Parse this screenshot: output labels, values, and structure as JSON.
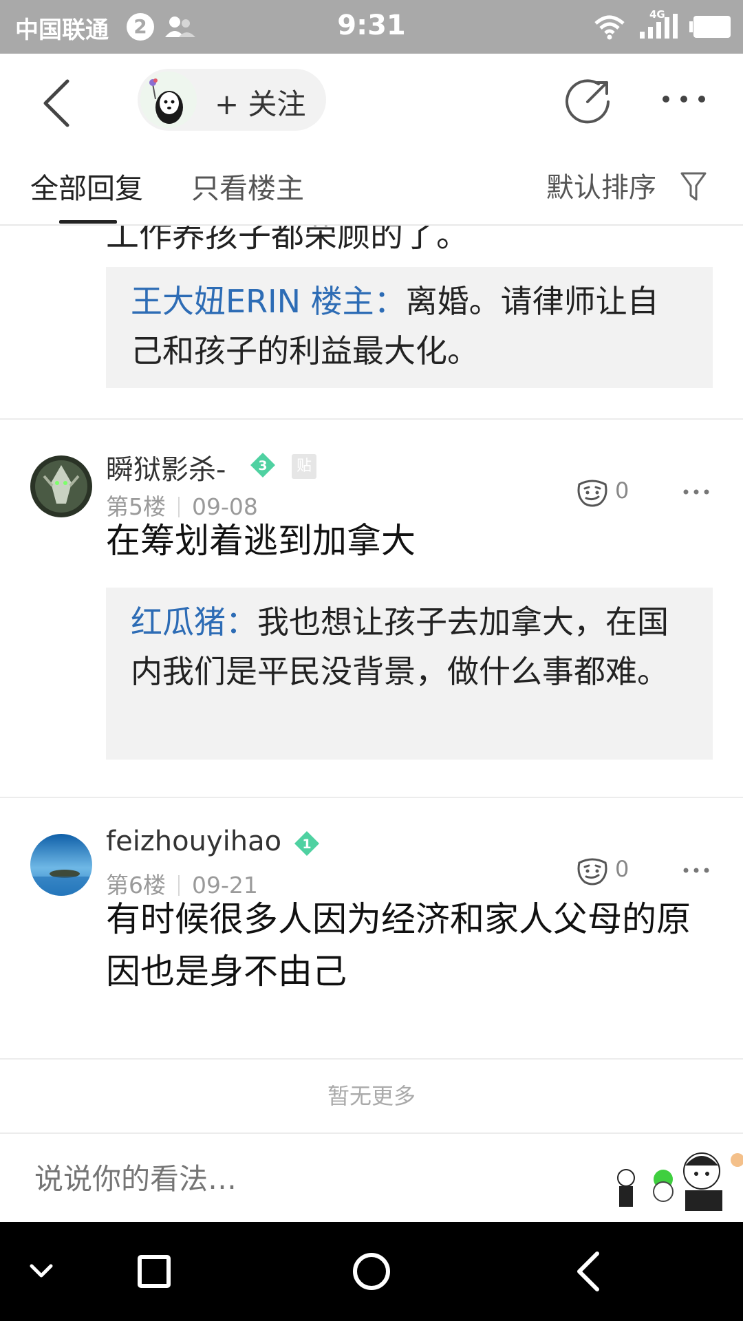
{
  "status_bar": {
    "carrier": "中国联通",
    "notification_count": "2",
    "time": "9:31",
    "network_type": "4G",
    "icons": [
      "contacts-icon",
      "wifi-icon",
      "signal-icon",
      "battery-icon"
    ]
  },
  "navbar": {
    "follow_label": "+ 关注",
    "icons": [
      "back-icon",
      "share-icon",
      "more-icon"
    ]
  },
  "tabs": {
    "all_replies": "全部回复",
    "only_op": "只看楼主",
    "sort_label": "默认排序"
  },
  "thread": {
    "partial_text": "工作养孩子都荣顾的了。",
    "top_quote": {
      "name": "王大妞ERIN 楼主：",
      "text": "离婚。请律师让自己和孩子的利益最大化。"
    },
    "posts": [
      {
        "username": "瞬狱影杀-",
        "level": "3",
        "badge": "贴",
        "floor": "第5楼",
        "date": "09-08",
        "likes": "0",
        "body": "在筹划着逃到加拿大",
        "quote": {
          "name": "红瓜猪：",
          "text": "我也想让孩子去加拿大，在国内我们是平民没背景，做什么事都难。"
        }
      },
      {
        "username": "feizhouyihao",
        "level": "1",
        "floor": "第6楼",
        "date": "09-21",
        "likes": "0",
        "body": "有时候很多人因为经济和家人父母的原因也是身不由己"
      }
    ],
    "end_label": "暂无更多"
  },
  "comment_bar": {
    "placeholder": "说说你的看法…"
  },
  "colors": {
    "status_bar": "#a9a9a9",
    "quote_name": "#2d6cb5",
    "level_badge": "#4fd1a1",
    "quote_bg": "#f2f2f2"
  }
}
